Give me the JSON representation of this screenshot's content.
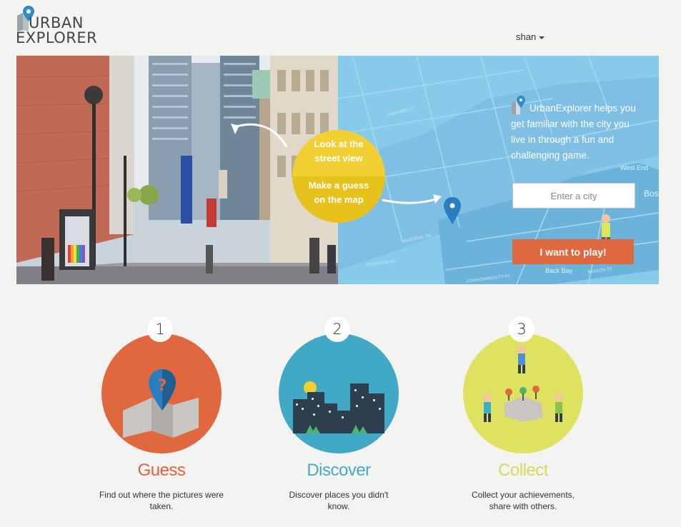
{
  "header": {
    "logo_line1": "URBAN",
    "logo_line2": "EXPLORER",
    "user_name": "shan"
  },
  "hero": {
    "bubble_top": "Look at the street view",
    "bubble_bottom": "Make a guess on the map",
    "blurb": "UrbanExplorer helps you get familiar with the city you live in through a fun and challenging game.",
    "city_placeholder": "Enter a city",
    "play_label": "I want to play!",
    "map_labels": [
      "HARVARD ST",
      "MEMORIAL DR",
      "STORROW DR",
      "COMMONWEALTH AV",
      "BEACON ST",
      "Back Bay",
      "West End",
      "Bos"
    ]
  },
  "steps": [
    {
      "number": "1",
      "title": "Guess",
      "desc": "Find out where the pictures were taken.",
      "color": "#e0683f",
      "title_color": "#d9643c"
    },
    {
      "number": "2",
      "title": "Discover",
      "desc": "Discover places you didn't know.",
      "color": "#41a9c6",
      "title_color": "#4aa9c2"
    },
    {
      "number": "3",
      "title": "Collect",
      "desc": "Collect your achievements, share with others.",
      "color": "#dfe160",
      "title_color": "#d7d85a"
    }
  ],
  "colors": {
    "accent_orange": "#e0683f",
    "accent_blue": "#41a9c6",
    "accent_yellow": "#dfe160",
    "map_blue": "#86c9ea"
  }
}
